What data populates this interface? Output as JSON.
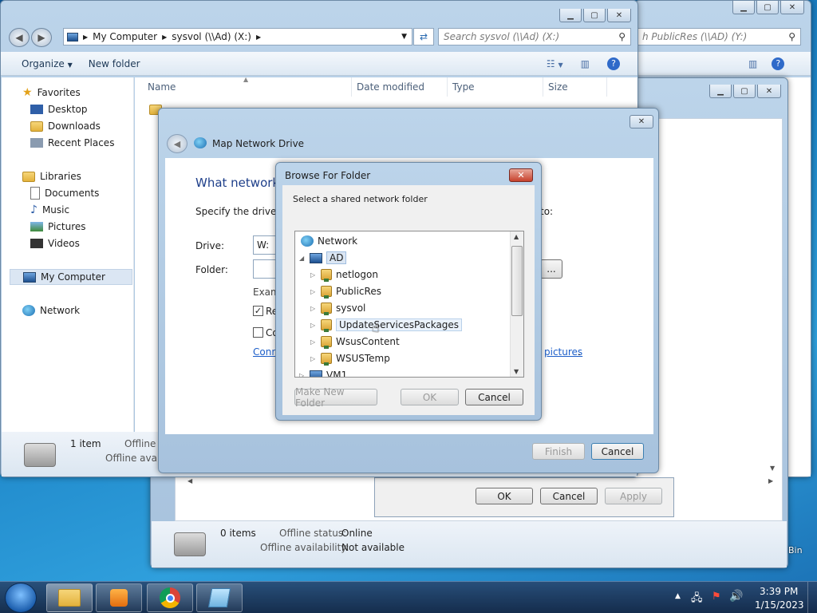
{
  "explorer_back": {
    "search_placeholder": "h PublicRes (\\\\AD) (Y:)",
    "status": {
      "items": "0 items",
      "offline_status_label": "Offline status:",
      "offline_status_value": "Online",
      "offline_avail_label": "Offline availability:",
      "offline_avail_value": "Not available"
    },
    "dialog_buttons": [
      "OK",
      "Cancel",
      "Apply"
    ]
  },
  "explorer_main": {
    "breadcrumb": [
      "My Computer",
      "sysvol (\\\\Ad) (X:)"
    ],
    "search_placeholder": "Search sysvol (\\\\Ad) (X:)",
    "toolbar": {
      "organize": "Organize",
      "new_folder": "New folder"
    },
    "nav": {
      "favorites": "Favorites",
      "fav_items": [
        "Desktop",
        "Downloads",
        "Recent Places"
      ],
      "libraries": "Libraries",
      "lib_items": [
        "Documents",
        "Music",
        "Pictures",
        "Videos"
      ],
      "my_computer": "My Computer",
      "network": "Network"
    },
    "columns": [
      "Name",
      "Date modified",
      "Type",
      "Size"
    ],
    "status": {
      "items": "1 item",
      "offline_status": "Offline s",
      "offline_avail": "Offline availa"
    }
  },
  "map_drive": {
    "title": "Map Network Drive",
    "heading": "What network",
    "instruction": "Specify the drive let",
    "instruction_tail": "to:",
    "drive_label": "Drive:",
    "drive_value": "W:",
    "folder_label": "Folder:",
    "browse_label": "...",
    "example_label": "Exam",
    "reconnect_label": "Re",
    "different_creds_label": "Co",
    "link_left": "Conn",
    "link_right": "pictures",
    "link_right_punct": ".",
    "finish": "Finish",
    "cancel": "Cancel"
  },
  "browse": {
    "title": "Browse For Folder",
    "instruction": "Select a shared network folder",
    "tree": {
      "network": "Network",
      "ad": "AD",
      "shares": [
        "netlogon",
        "PublicRes",
        "sysvol",
        "UpdateServicesPackages",
        "WsusContent",
        "WSUSTemp"
      ],
      "vm1": "VM1"
    },
    "make_new_folder": "Make New Folder",
    "ok": "OK",
    "cancel": "Cancel"
  },
  "taskbar": {
    "time": "3:39 PM",
    "date": "1/15/2023",
    "recycle_label": "Bin"
  }
}
